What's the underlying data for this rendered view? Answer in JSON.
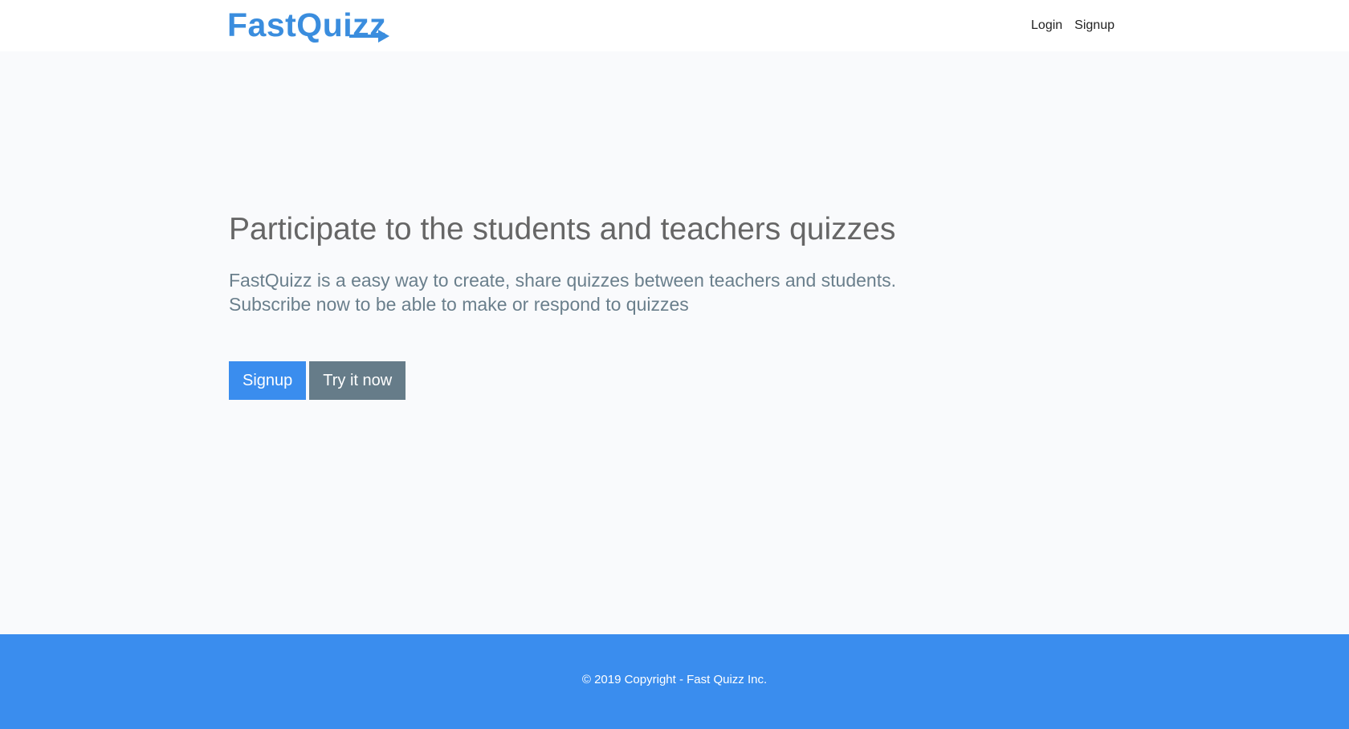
{
  "header": {
    "brand": "FastQuizz",
    "nav": {
      "login": "Login",
      "signup": "Signup"
    }
  },
  "hero": {
    "title": "Participate to the students and teachers quizzes",
    "subtitle_line1": "FastQuizz is a easy way to create, share quizzes between teachers and students.",
    "subtitle_line2": "Subscribe now to be able to make or respond to quizzes",
    "signup_button": "Signup",
    "try_button": "Try it now"
  },
  "footer": {
    "copyright": "© 2019 Copyright - Fast Quizz Inc."
  },
  "colors": {
    "brand": "#3a8dde",
    "primary_button": "#3a8dee",
    "secondary_button": "#667c89",
    "hero_background": "#f9fafc",
    "footer_background": "#3a8dee"
  }
}
